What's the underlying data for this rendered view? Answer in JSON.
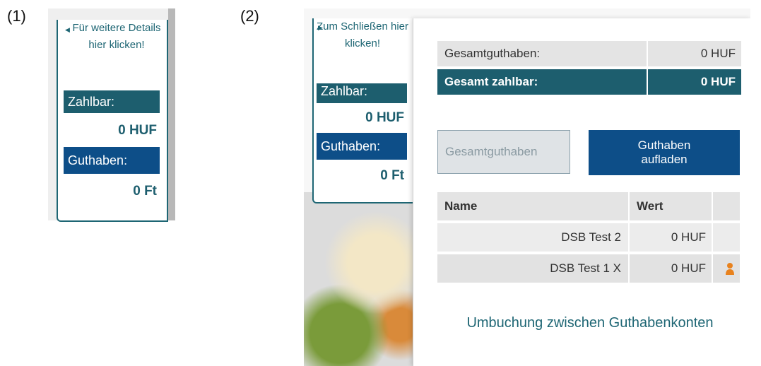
{
  "figure_labels": [
    "(1)",
    "(2)"
  ],
  "panel1": {
    "toggle_text": "Für weitere Details hier klicken!",
    "payable_label": "Zahlbar:",
    "payable_value": "0 HUF",
    "credit_label": "Guthaben:",
    "credit_value": "0 Ft"
  },
  "panel2": {
    "sidebar": {
      "toggle_text": "Zum Schließen hier klicken!",
      "payable_label": "Zahlbar:",
      "payable_value": "0 HUF",
      "credit_label": "Guthaben:",
      "credit_value": "0 Ft"
    },
    "summary": [
      {
        "label": "Gesamtguthaben:",
        "value": "0 HUF"
      },
      {
        "label": "Gesamt zahlbar:",
        "value": "0 HUF"
      }
    ],
    "buttons": {
      "total_credit": "Gesamtguthaben",
      "top_up": "Guthaben aufladen"
    },
    "accounts": {
      "headers": [
        "Name",
        "Wert"
      ],
      "rows": [
        {
          "name": "DSB Test 2",
          "value": "0 HUF"
        },
        {
          "name": "DSB Test 1 X",
          "value": "0 HUF",
          "icon": "person-icon"
        }
      ]
    },
    "transfer_link": "Umbuchung zwischen Guthabenkonten"
  },
  "colors": {
    "teal": "#1d5e6e",
    "blue": "#0d4e88",
    "orange": "#e8821e"
  }
}
